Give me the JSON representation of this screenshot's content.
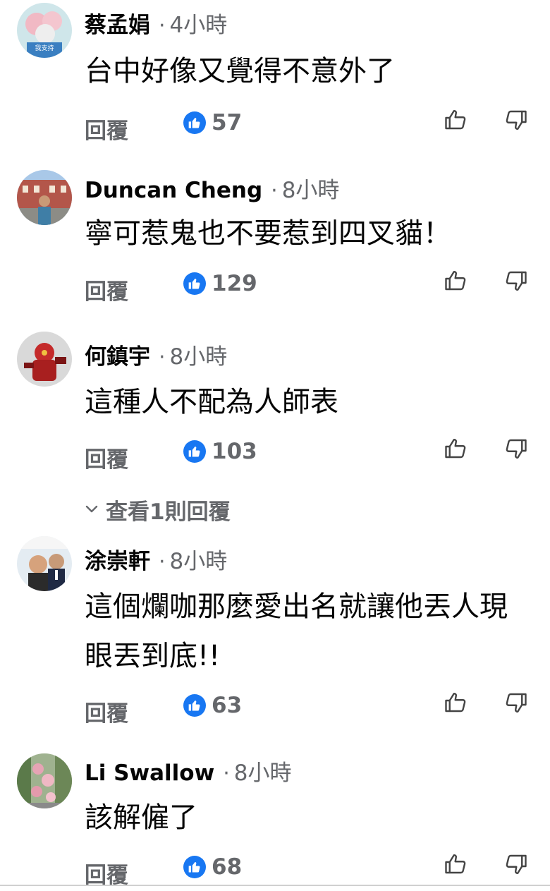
{
  "comments": [
    {
      "name": "蔡孟娟",
      "time": "4小時",
      "text": "台中好像又覺得不意外了",
      "reply": "回覆",
      "likes": "57",
      "avatar_text": "我支持"
    },
    {
      "name": "Duncan Cheng",
      "time": "8小時",
      "text": "寧可惹鬼也不要惹到四叉貓！",
      "reply": "回覆",
      "likes": "129"
    },
    {
      "name": "何鎮宇",
      "time": "8小時",
      "text": "這種人不配為人師表",
      "reply": "回覆",
      "likes": "103",
      "view_replies": "查看1則回覆"
    },
    {
      "name": "涂崇軒",
      "time": "8小時",
      "text": "這個爛咖那麼愛出名就讓他丟人現眼丟到底!!",
      "reply": "回覆",
      "likes": "63"
    },
    {
      "name": "Li Swallow",
      "time": "8小時",
      "text": "該解僱了",
      "reply": "回覆",
      "likes": "68"
    }
  ],
  "separator": "·",
  "icons": {
    "like_badge": "like-badge-icon",
    "thumb_up": "thumb-up-icon",
    "thumb_down": "thumb-down-icon",
    "chevron": "chevron-down-icon"
  },
  "colors": {
    "like_blue": "#1877f2",
    "meta_gray": "#65676b",
    "text": "#050505"
  }
}
